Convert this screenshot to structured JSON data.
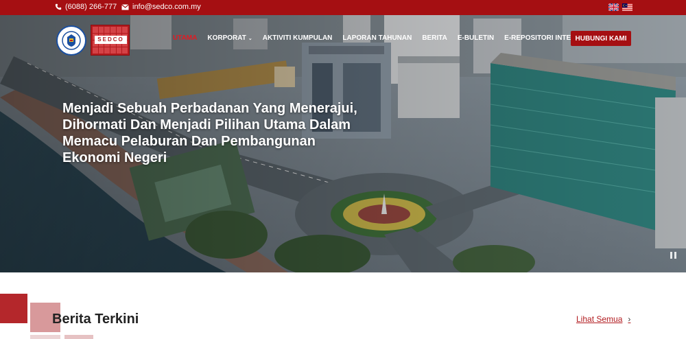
{
  "topbar": {
    "phone": "(6088) 266-777",
    "email": "info@sedco.com.my",
    "phone_icon": "phone-icon",
    "email_icon": "envelope-icon",
    "languages": [
      "english-flag",
      "malay-flag"
    ]
  },
  "header": {
    "logo_wordmark": "SEDCO",
    "nav": [
      {
        "label": "UTAMA",
        "active": true
      },
      {
        "label": "KORPORAT",
        "dropdown": true
      },
      {
        "label": "AKTIVITI KUMPULAN"
      },
      {
        "label": "LAPORAN TAHUNAN"
      },
      {
        "label": "BERITA"
      },
      {
        "label": "E-BULETIN"
      },
      {
        "label": "E-REPOSITORI INTEGRITI"
      }
    ],
    "cta_label": "HUBUNGI KAMI"
  },
  "hero": {
    "headline_lines": [
      "Menjadi Sebuah Perbadanan Yang Menerajui,",
      "Dihormati Dan Menjadi Pilihan Utama Dalam",
      "Memacu Pelaburan Dan Pembangunan",
      "Ekonomi Negeri"
    ]
  },
  "news": {
    "title": "Berita Terkini",
    "see_all": "Lihat Semua",
    "arrow": "›"
  },
  "colors": {
    "brand_red": "#a50f12",
    "accent_red": "#e21b22"
  }
}
